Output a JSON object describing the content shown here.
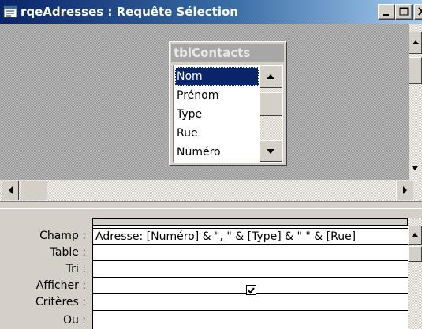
{
  "window": {
    "title": "rqeAdresses : Requête Sélection"
  },
  "field_list": {
    "table_name": "tblContacts",
    "fields": [
      "Nom",
      "Prénom",
      "Type",
      "Rue",
      "Numéro"
    ],
    "selected_field": "Nom"
  },
  "grid": {
    "row_labels": {
      "champ": "Champ :",
      "table": "Table :",
      "tri": "Tri :",
      "afficher": "Afficher :",
      "criteres": "Critères :",
      "ou": "Ou :"
    },
    "column1": {
      "champ": "Adresse: [Numéro] & \", \" & [Type] & \" \" & [Rue]",
      "table": "",
      "tri": "",
      "afficher_checked": true,
      "criteres": ""
    }
  },
  "icons": {
    "title_icon": "query-icon",
    "minimize": "minimize-icon",
    "maximize": "maximize-icon",
    "close": "close-icon"
  },
  "colors": {
    "title_start": "#0a246a",
    "selection": "#0a246a",
    "chrome": "#d4d0c8"
  }
}
